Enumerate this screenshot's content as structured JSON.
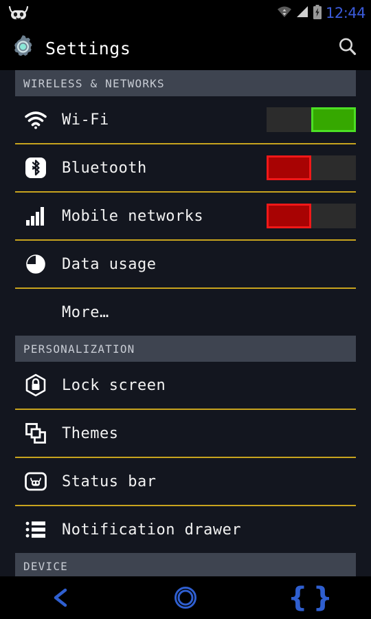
{
  "statusbar": {
    "logo_icon": "cyanogenmod-logo-icon",
    "wifi_icon": "wifi-signal-icon",
    "cell_icon": "cellular-signal-icon",
    "battery_icon": "battery-charging-icon",
    "clock": "12:44",
    "clock_color": "#3b5bdb"
  },
  "actionbar": {
    "app_icon": "settings-gear-icon",
    "title": "Settings",
    "search_icon": "search-icon"
  },
  "sections": [
    {
      "header": "WIRELESS & NETWORKS",
      "rows": [
        {
          "label": "Wi-Fi",
          "icon": "wifi-icon",
          "toggle": "on",
          "divider_after": true
        },
        {
          "label": "Bluetooth",
          "icon": "bluetooth-icon",
          "toggle": "off",
          "divider_after": true
        },
        {
          "label": "Mobile networks",
          "icon": "signal-bars-icon",
          "toggle": "off",
          "divider_after": true
        },
        {
          "label": "Data usage",
          "icon": "pie-chart-icon",
          "toggle": "none",
          "divider_after": true
        },
        {
          "label": "More…",
          "icon": "none",
          "toggle": "none",
          "divider_after": false
        }
      ]
    },
    {
      "header": "PERSONALIZATION",
      "rows": [
        {
          "label": "Lock screen",
          "icon": "lock-icon",
          "toggle": "none",
          "divider_after": true
        },
        {
          "label": "Themes",
          "icon": "themes-icon",
          "toggle": "none",
          "divider_after": true
        },
        {
          "label": "Status bar",
          "icon": "status-bar-icon",
          "toggle": "none",
          "divider_after": true
        },
        {
          "label": "Notification drawer",
          "icon": "notification-list-icon",
          "toggle": "none",
          "divider_after": false
        }
      ]
    },
    {
      "header": "DEVICE",
      "rows": []
    }
  ],
  "navbar": {
    "back_icon": "back-arrow-icon",
    "home_icon": "home-circle-icon",
    "recents_glyph": "{ }",
    "color": "#2f5fd0"
  },
  "theme": {
    "background": "#13161f",
    "header_band": "#3e4450",
    "divider": "#c8a41e",
    "toggle_on_fill": "#36a800",
    "toggle_on_border": "#4ce024",
    "toggle_off_fill": "#a80303",
    "toggle_off_border": "#f01818"
  }
}
